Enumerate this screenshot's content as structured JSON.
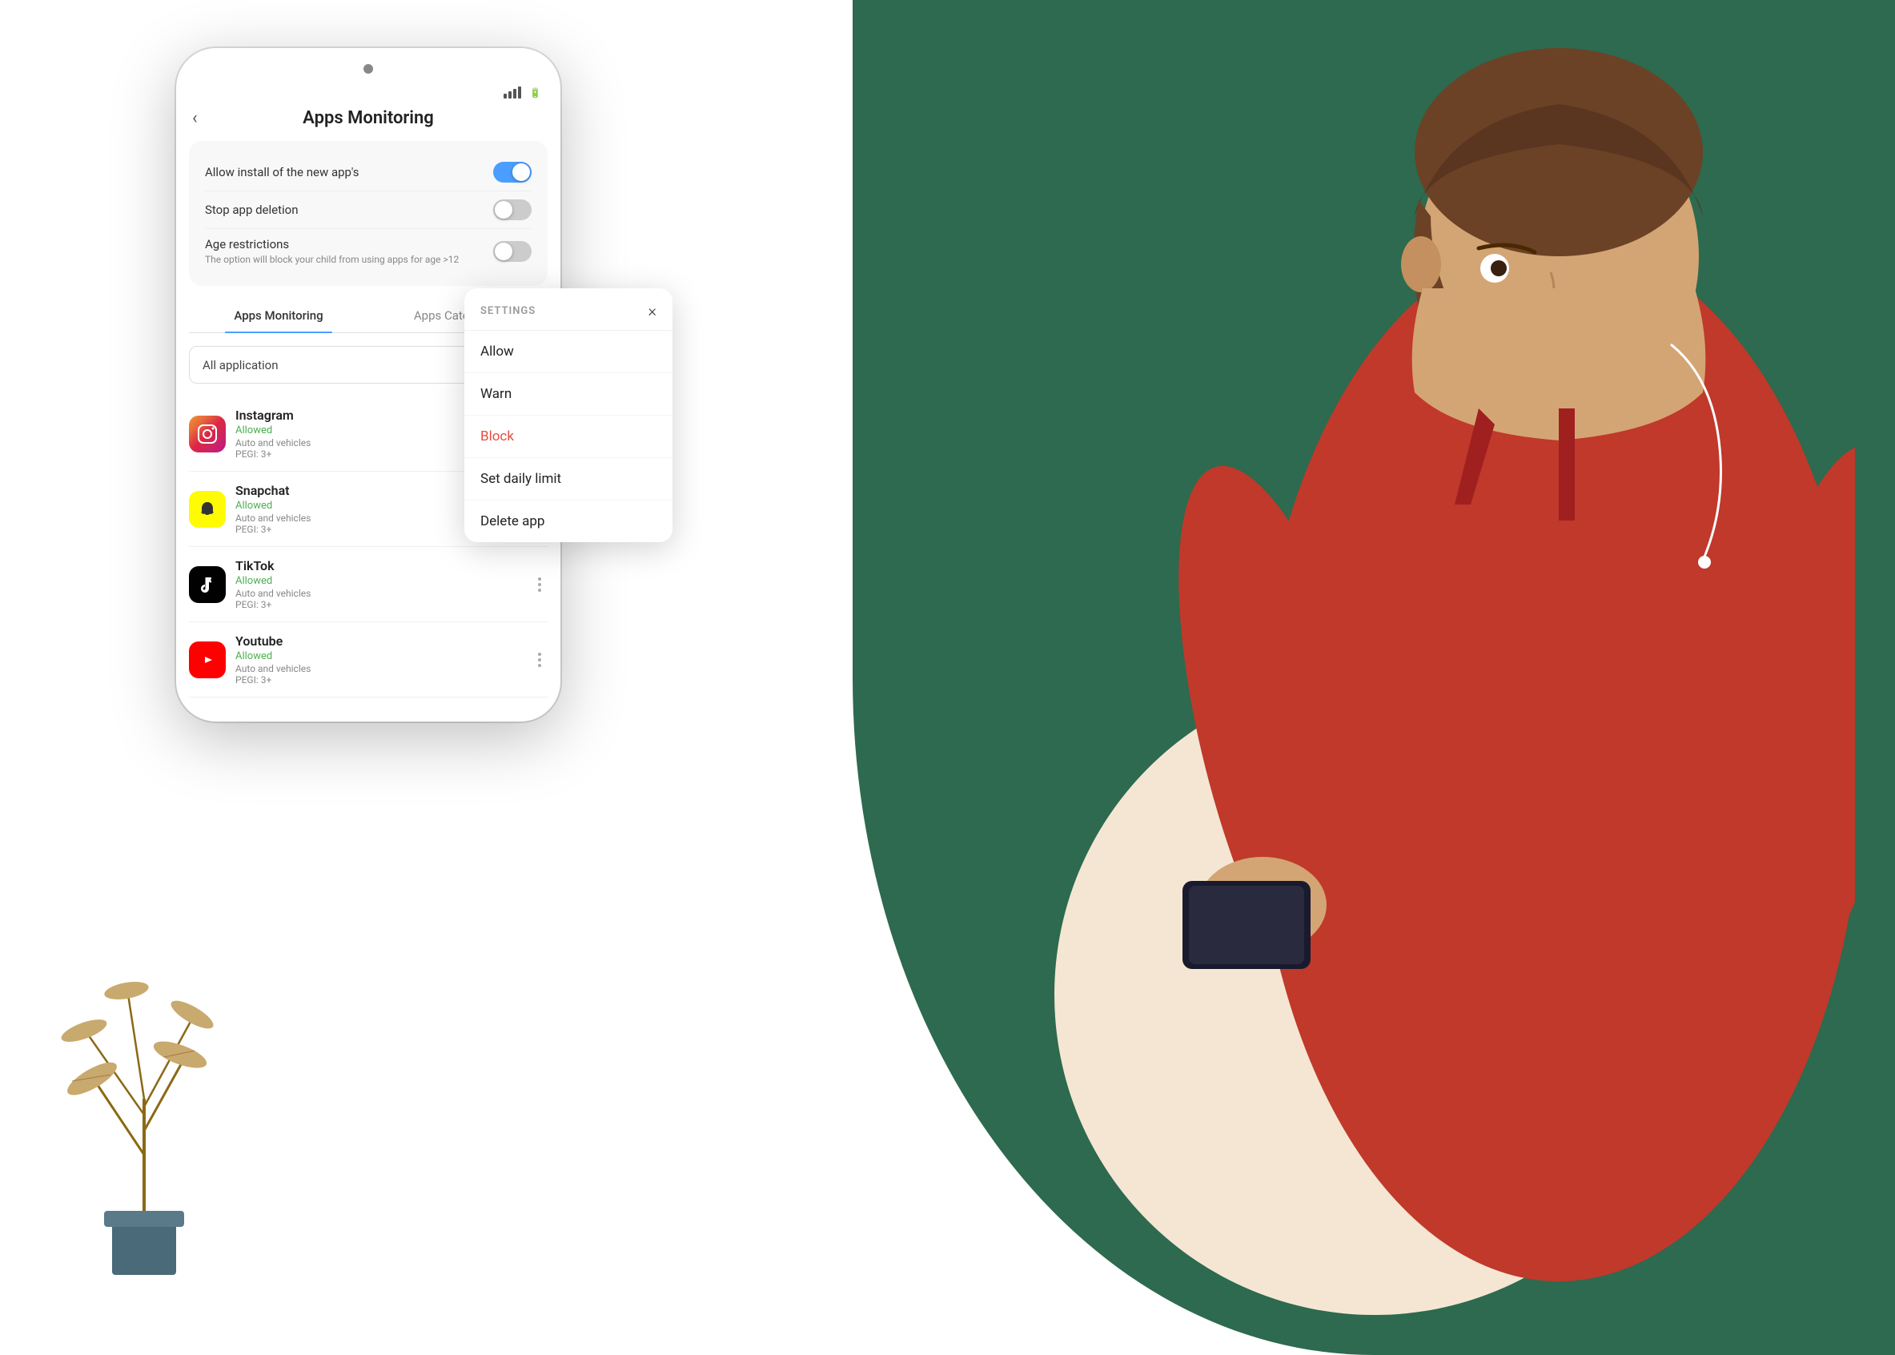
{
  "background": {
    "green_color": "#2d6a4f",
    "cream_color": "#f5e6d3"
  },
  "phone": {
    "title": "Apps Monitoring",
    "back_label": "‹",
    "settings": {
      "allow_install_label": "Allow install of the new app's",
      "allow_install_state": "on",
      "stop_deletion_label": "Stop app deletion",
      "stop_deletion_state": "off",
      "age_restrictions_label": "Age restrictions",
      "age_restrictions_state": "off",
      "age_restrictions_sub": "The option will block your child from using apps for age >12"
    },
    "tabs": [
      {
        "id": "monitoring",
        "label": "Apps Monitoring",
        "active": true
      },
      {
        "id": "categories",
        "label": "Apps Categories",
        "active": false
      }
    ],
    "dropdown": {
      "label": "All application",
      "arrow": "⌄"
    },
    "apps": [
      {
        "name": "Instagram",
        "status": "Allowed",
        "category": "Auto and vehicles",
        "pegi": "PEGI: 3+",
        "icon_type": "instagram"
      },
      {
        "name": "Snapchat",
        "status": "Allowed",
        "category": "Auto and vehicles",
        "pegi": "PEGI: 3+",
        "icon_type": "snapchat"
      },
      {
        "name": "TikTok",
        "status": "Allowed",
        "category": "Auto and vehicles",
        "pegi": "PEGI: 3+",
        "icon_type": "tiktok"
      },
      {
        "name": "Youtube",
        "status": "Allowed",
        "category": "Auto and vehicles",
        "pegi": "PEGI: 3+",
        "icon_type": "youtube"
      }
    ]
  },
  "settings_popup": {
    "title": "SETTINGS",
    "close_label": "×",
    "items": [
      {
        "label": "Allow",
        "style": "normal"
      },
      {
        "label": "Warn",
        "style": "normal"
      },
      {
        "label": "Block",
        "style": "block"
      },
      {
        "label": "Set daily limit",
        "style": "normal"
      },
      {
        "label": "Delete app",
        "style": "normal"
      }
    ]
  }
}
